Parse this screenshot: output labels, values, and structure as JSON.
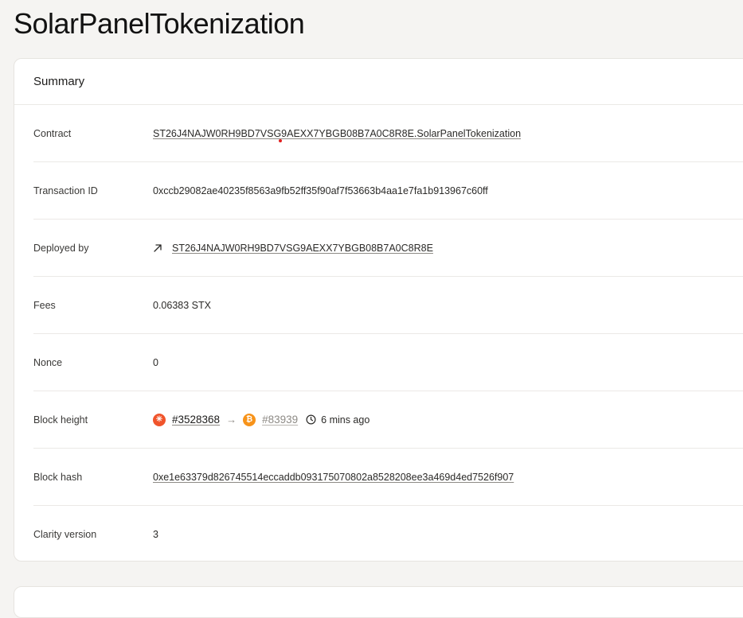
{
  "page": {
    "title": "SolarPanelTokenization"
  },
  "summary": {
    "title": "Summary",
    "rows": {
      "contract": {
        "label": "Contract",
        "value": "ST26J4NAJW0RH9BD7VSG9AEXX7YBGB08B7A0C8R8E.SolarPanelTokenization"
      },
      "transaction_id": {
        "label": "Transaction ID",
        "value": "0xccb29082ae40235f8563a9fb52ff35f90af7f53663b4aa1e7fa1b913967c60ff"
      },
      "deployed_by": {
        "label": "Deployed by",
        "value": "ST26J4NAJW0RH9BD7VSG9AEXX7YBGB08B7A0C8R8E",
        "icon": "arrow-up-right-icon"
      },
      "fees": {
        "label": "Fees",
        "value": "0.06383 STX"
      },
      "nonce": {
        "label": "Nonce",
        "value": "0"
      },
      "block_height": {
        "label": "Block height",
        "stacks_block": "#3528368",
        "bitcoin_block": "#83939",
        "time": "6 mins ago",
        "stacks_icon": "stacks-icon",
        "bitcoin_icon": "bitcoin-icon",
        "clock_icon": "clock-icon",
        "stacks_color": "#f0542b",
        "bitcoin_color": "#f7931a"
      },
      "block_hash": {
        "label": "Block hash",
        "value": "0xe1e63379d826745514eccaddb093175070802a8528208ee3a469d4ed7526f907"
      },
      "clarity_version": {
        "label": "Clarity version",
        "value": "3"
      }
    }
  }
}
